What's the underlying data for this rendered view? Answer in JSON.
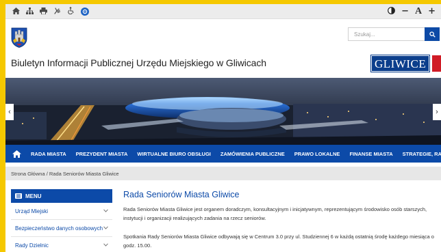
{
  "toolbar": {
    "left_icons": [
      "home-icon",
      "sitemap-icon",
      "print-icon",
      "sign-language-icon",
      "accessibility-icon",
      "help-icon"
    ],
    "contrast_icon": "contrast-icon",
    "font_decrease": "−",
    "font_default": "A",
    "font_increase": "+"
  },
  "header": {
    "site_title": "Biuletyn Informacji Publicznej Urzędu Miejskiego w Gliwicach",
    "search_placeholder": "Szukaj...",
    "logo_text": "GLIWICE"
  },
  "hero": {
    "prev_arrow": "‹",
    "next_arrow": "›"
  },
  "nav": {
    "items": [
      "RADA MIASTA",
      "PREZYDENT MIASTA",
      "WIRTUALNE BIURO OBSŁUGI",
      "ZAMÓWIENIA PUBLICZNE",
      "PRAWO LOKALNE",
      "FINANSE MIASTA",
      "STRATEGIE, RAPORTY"
    ]
  },
  "breadcrumb": "Strona Główna / Rada Seniorów Miasta Gliwice",
  "sidebar": {
    "heading": "MENU",
    "items": [
      "Urząd Miejski",
      "Bezpieczeństwo danych osobowych",
      "Rady Dzielnic"
    ]
  },
  "content": {
    "title": "Rada Seniorów Miasta Gliwice",
    "paragraphs": [
      "Rada Seniorów Miasta Gliwice jest organem doradczym, konsultacyjnym i inicjatywnym, reprezentującym środowisko osób starszych, instytucji i organizacji realizujących zadania na rzecz seniorów.",
      "Spotkania Rady Seniorów Miasta Gliwice odbywają się w Centrum 3.0 przy ul. Studziennej 6 w każdą ostatnią środę każdego miesiąca o godz. 15.00."
    ]
  },
  "colors": {
    "frame": "#f5c800",
    "primary_blue": "#0c4aa8",
    "logo_red": "#d01c26"
  }
}
